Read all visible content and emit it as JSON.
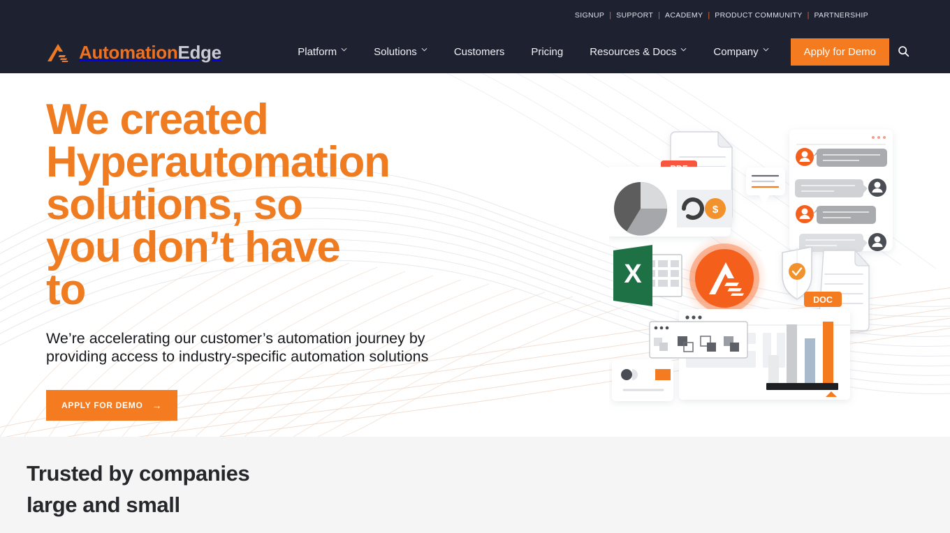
{
  "topbar": {
    "links": [
      "SIGNUP",
      "SUPPORT",
      "ACADEMY",
      "PRODUCT COMMUNITY",
      "PARTNERSHIP"
    ],
    "separator": "|",
    "background": "#1d2130",
    "link_color": "#dfe2ea",
    "separator_color": "#e2622c"
  },
  "logo": {
    "name_first": "Automation",
    "name_second": "Edge",
    "first_color": "#f07021",
    "second_color": "#c9ccd4",
    "mark_color": "#f07a24"
  },
  "nav": {
    "items": [
      {
        "label": "Platform",
        "has_dropdown": true
      },
      {
        "label": "Solutions",
        "has_dropdown": true
      },
      {
        "label": "Customers",
        "has_dropdown": false
      },
      {
        "label": "Pricing",
        "has_dropdown": false
      },
      {
        "label": "Resources & Docs",
        "has_dropdown": true
      },
      {
        "label": "Company",
        "has_dropdown": true
      }
    ],
    "demo_button": "Apply for Demo",
    "demo_button_color": "#f57b20",
    "search_icon": "search-icon"
  },
  "hero": {
    "headline": "We created Hyperautomation solutions, so you don’t have to",
    "headline_color": "#f07c22",
    "subhead": "We’re accelerating our customer’s automation journey by providing access to industry-specific automation solutions",
    "cta_label": "APPLY FOR DEMO",
    "cta_arrow": "→",
    "cta_color": "#f57b20",
    "illustration": {
      "pdf_badge": "PDF",
      "pdf_badge_color": "#f9553d",
      "doc_badge": "DOC",
      "doc_badge_color": "#f57b20",
      "excel_letter": "X",
      "excel_color": "#1d7145",
      "coin_symbol": "$",
      "coin_color": "#f2922c",
      "logo_badge_color": "#f4601c",
      "shield_check_color": "#f2922c",
      "chart_bar_colors": [
        "#e9eaec",
        "#c9cbcf",
        "#a8bacb",
        "#f57b20"
      ]
    }
  },
  "trusted": {
    "line1": "Trusted by companies",
    "line2": "large and small",
    "background": "#f5f5f5",
    "text_color": "#26272b"
  }
}
